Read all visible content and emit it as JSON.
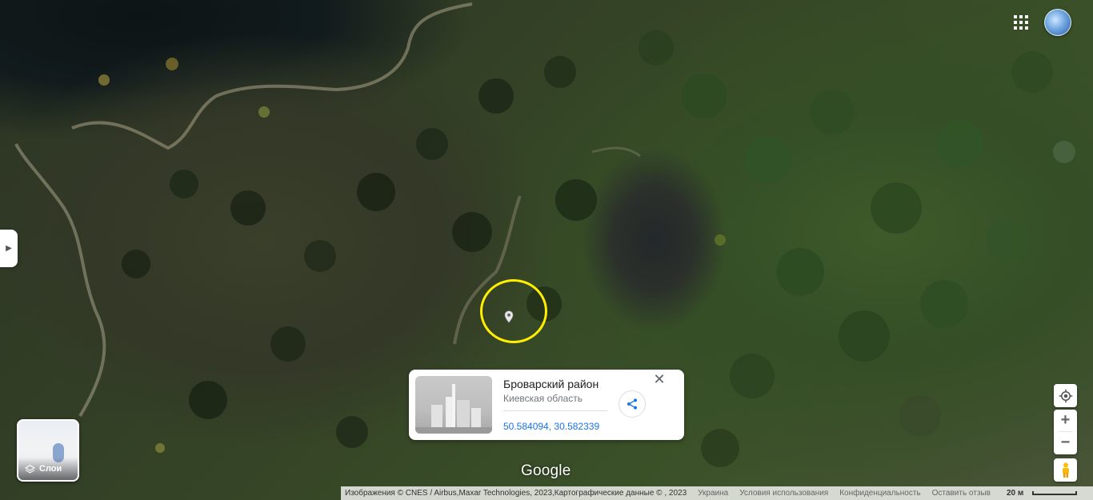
{
  "map": {
    "logo": "Google"
  },
  "place_card": {
    "title": "Броварский район",
    "subtitle": "Киевская область",
    "coordinates": "50.584094, 30.582339",
    "close_icon": "close-icon",
    "share_icon": "share-icon"
  },
  "layers_button": {
    "label": "Слои",
    "icon": "layers-icon"
  },
  "controls": {
    "zoom_in_label": "+",
    "zoom_out_label": "−",
    "locate_icon": "my-location-icon",
    "pegman_icon": "pegman-icon",
    "apps_icon": "apps-grid-icon",
    "account_icon": "globe-icon",
    "side_panel_icon": "chevron-right-icon"
  },
  "footer": {
    "attribution": "Изображения © CNES / Airbus,Maxar Technologies, 2023,Картографические данные © , 2023",
    "country": "Украина",
    "terms": "Условия использования",
    "privacy": "Конфиденциальность",
    "feedback": "Оставить отзыв",
    "scale_label": "20 м"
  },
  "colors": {
    "highlight_ring": "#ffee00",
    "link": "#1a73e8"
  }
}
